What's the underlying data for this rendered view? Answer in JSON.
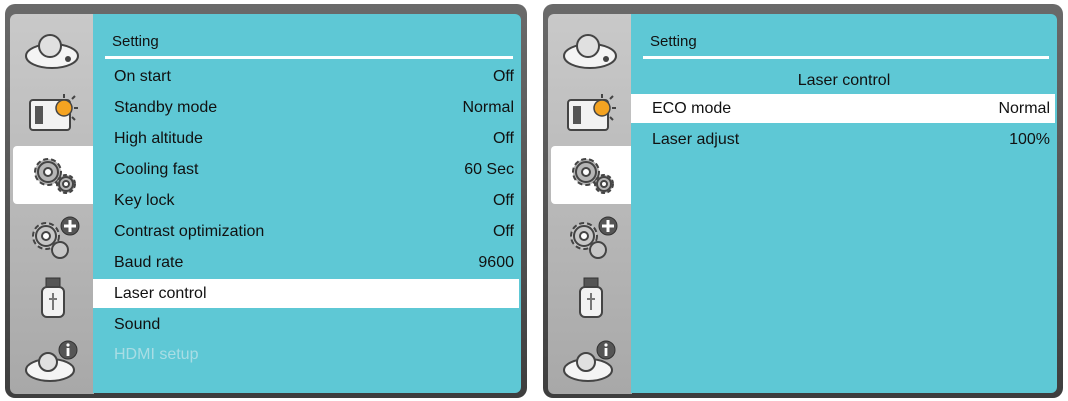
{
  "left_screen": {
    "title": "Setting",
    "items": [
      {
        "label": "On start",
        "value": "Off"
      },
      {
        "label": "Standby mode",
        "value": "Normal"
      },
      {
        "label": "High altitude",
        "value": "Off"
      },
      {
        "label": "Cooling fast",
        "value": "60 Sec"
      },
      {
        "label": "Key lock",
        "value": "Off"
      },
      {
        "label": "Contrast optimization",
        "value": "Off"
      },
      {
        "label": "Baud rate",
        "value": "9600"
      },
      {
        "label": "Laser control",
        "value": ""
      },
      {
        "label": "Sound",
        "value": ""
      },
      {
        "label": "HDMI setup",
        "value": ""
      }
    ],
    "selected_item": "Laser control",
    "disabled_item": "HDMI setup"
  },
  "right_screen": {
    "title": "Setting",
    "subtitle": "Laser control",
    "items": [
      {
        "label": "ECO mode",
        "value": "Normal"
      },
      {
        "label": "Laser adjust",
        "value": "100%"
      }
    ],
    "selected_item": "ECO mode"
  },
  "sidebar_tabs": [
    "projector-input-icon",
    "projector-display-icon",
    "setting-gears-icon",
    "expanded-setting-gears-icon",
    "usb-drive-icon",
    "projector-info-icon"
  ],
  "active_tab": "setting-gears-icon",
  "colors": {
    "menu_background": "#5ec8d5",
    "selected_row": "#ffffff",
    "disabled_text": "#a9dde4",
    "sidebar": "#b8b8b8",
    "frame": "#555555"
  }
}
